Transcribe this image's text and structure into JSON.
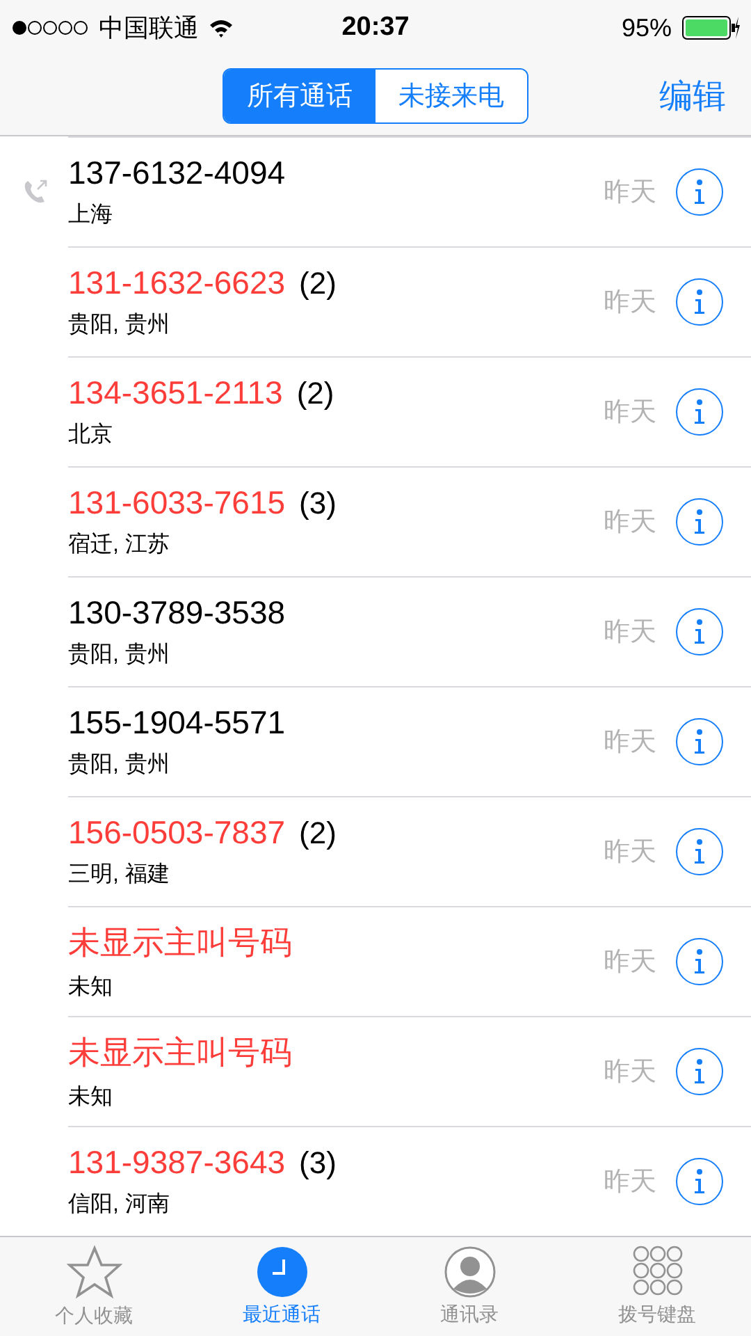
{
  "status_bar": {
    "carrier": "中国联通",
    "time": "20:37",
    "battery": "95%"
  },
  "nav": {
    "segments": [
      {
        "label": "所有通话",
        "selected": true
      },
      {
        "label": "未接来电",
        "selected": false
      }
    ],
    "edit": "编辑"
  },
  "calls": [
    {
      "number": "137-6132-4094",
      "location": "上海",
      "time": "昨天",
      "missed": false,
      "outgoing": true
    },
    {
      "number": "131-1632-6623",
      "count": "(2)",
      "location": "贵阳, 贵州",
      "time": "昨天",
      "missed": true,
      "outgoing": false
    },
    {
      "number": "134-3651-2113",
      "count": "(2)",
      "location": "北京",
      "time": "昨天",
      "missed": true,
      "outgoing": false
    },
    {
      "number": "131-6033-7615",
      "count": "(3)",
      "location": "宿迁, 江苏",
      "time": "昨天",
      "missed": true,
      "outgoing": false
    },
    {
      "number": "130-3789-3538",
      "location": "贵阳, 贵州",
      "time": "昨天",
      "missed": false,
      "outgoing": false
    },
    {
      "number": "155-1904-5571",
      "location": "贵阳, 贵州",
      "time": "昨天",
      "missed": false,
      "outgoing": false
    },
    {
      "number": "156-0503-7837",
      "count": "(2)",
      "location": "三明, 福建",
      "time": "昨天",
      "missed": true,
      "outgoing": false
    },
    {
      "number": "未显示主叫号码",
      "location": "未知",
      "time": "昨天",
      "missed": true,
      "outgoing": false
    },
    {
      "number": "未显示主叫号码",
      "location": "未知",
      "time": "昨天",
      "missed": true,
      "outgoing": false
    },
    {
      "number": "131-9387-3643",
      "count": "(3)",
      "location": "信阳, 河南",
      "time": "昨天",
      "missed": true,
      "outgoing": false
    }
  ],
  "tab_bar": [
    {
      "kind": "favorites",
      "label": "个人收藏",
      "selected": false
    },
    {
      "kind": "recents",
      "label": "最近通话",
      "selected": true
    },
    {
      "kind": "contacts",
      "label": "通讯录",
      "selected": false
    },
    {
      "kind": "keypad",
      "label": "拨号键盘",
      "selected": false
    }
  ]
}
